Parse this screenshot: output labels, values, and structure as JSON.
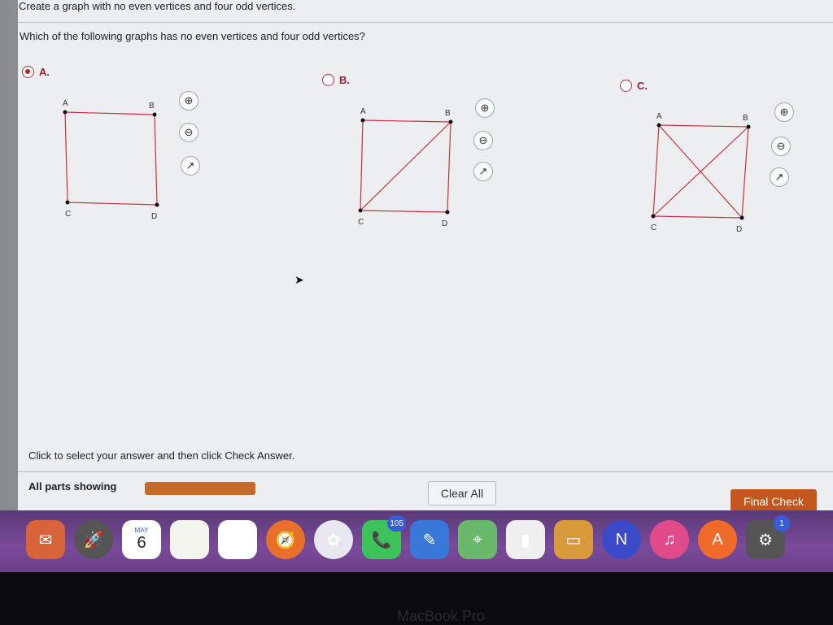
{
  "header": {
    "title": "Create a graph with no even vertices and four odd vertices.",
    "question": "Which of the following graphs has no even vertices and four odd vertices?"
  },
  "options": [
    {
      "label": "A.",
      "selected": true,
      "vertices": [
        "A",
        "B",
        "C",
        "D"
      ],
      "edges": [
        [
          "A",
          "B"
        ],
        [
          "A",
          "C"
        ],
        [
          "B",
          "D"
        ],
        [
          "C",
          "D"
        ]
      ]
    },
    {
      "label": "B.",
      "selected": false,
      "vertices": [
        "A",
        "B",
        "C",
        "D"
      ],
      "edges": [
        [
          "A",
          "B"
        ],
        [
          "A",
          "C"
        ],
        [
          "B",
          "D"
        ],
        [
          "C",
          "D"
        ],
        [
          "B",
          "C"
        ]
      ]
    },
    {
      "label": "C.",
      "selected": false,
      "vertices": [
        "A",
        "B",
        "C",
        "D"
      ],
      "edges": [
        [
          "A",
          "B"
        ],
        [
          "A",
          "C"
        ],
        [
          "B",
          "D"
        ],
        [
          "C",
          "D"
        ],
        [
          "A",
          "D"
        ],
        [
          "B",
          "C"
        ]
      ]
    }
  ],
  "icons": [
    "zoom-in-icon",
    "zoom-out-icon",
    "popout-icon"
  ],
  "edge_color": "#c8323c",
  "instruction": "Click to select your answer and then click Check Answer.",
  "footer": {
    "parts_label": "All parts showing",
    "progress_color": "#c56a2a",
    "clear_label": "Clear All",
    "final_label": "Final Check"
  },
  "dock": {
    "calendar_month": "MAY",
    "calendar_day": "6",
    "facetime_badge": "105",
    "settings_badge": "1",
    "apps": [
      "Mail Stamp",
      "Launchpad",
      "Calendar",
      "Notes",
      "Reminders",
      "Safari",
      "Photos",
      "FaceTime",
      "Pages",
      "Maps",
      "Numbers",
      "Keynote",
      "News",
      "Music",
      "App Store",
      "System Preferences"
    ]
  },
  "bezel_label": "MacBook Pro"
}
